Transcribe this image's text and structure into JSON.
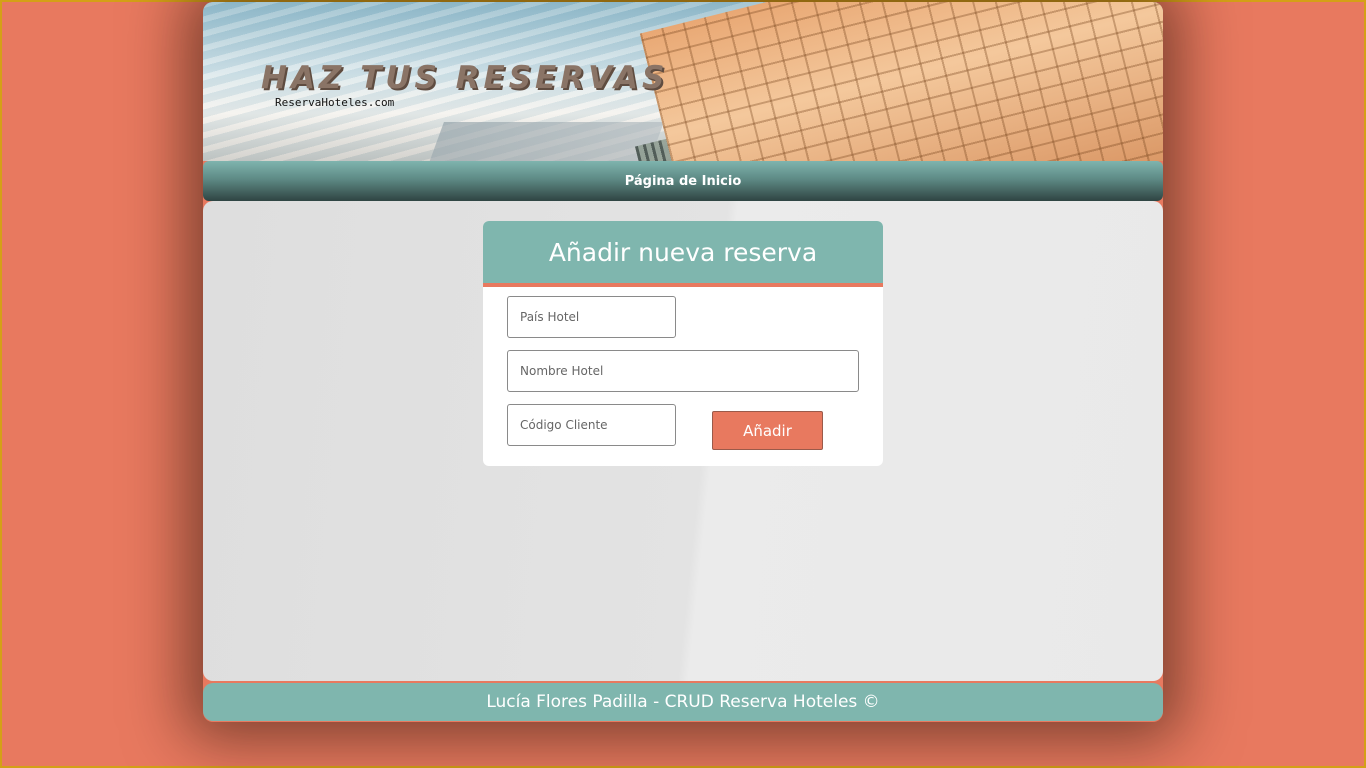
{
  "banner": {
    "title": "HAZ TUS RESERVAS",
    "subtitle": "ReservaHoteles.com"
  },
  "nav": {
    "home_label": "Página de Inicio"
  },
  "form": {
    "title": "Añadir nueva reserva",
    "pais_placeholder": "País Hotel",
    "nombre_placeholder": "Nombre Hotel",
    "codigo_placeholder": "Código Cliente",
    "submit_label": "Añadir"
  },
  "footer": {
    "text": "Lucía Flores Padilla - CRUD Reserva Hoteles ©"
  },
  "colors": {
    "page_bg": "#e8795f",
    "accent_teal": "#7fb6ae",
    "button": "#e8795f",
    "frame_border": "#d4a017"
  }
}
